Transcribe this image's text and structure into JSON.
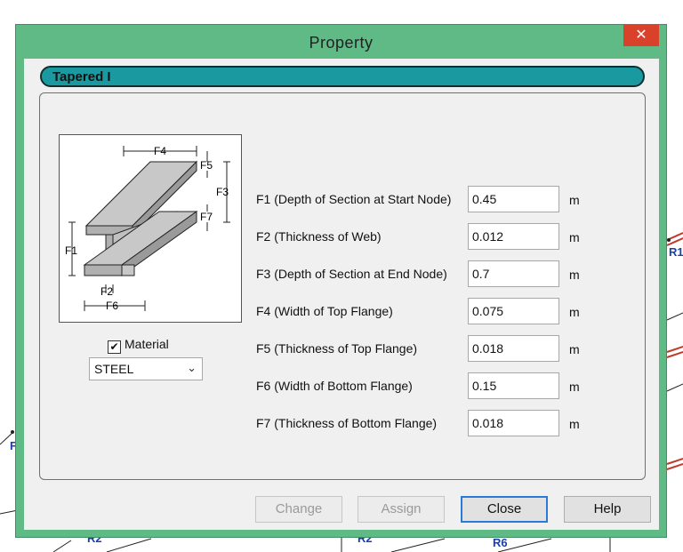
{
  "window": {
    "title": "Property",
    "close_glyph": "✕"
  },
  "section_header": "Tapered I",
  "diagram": {
    "labels": {
      "F1": "F1",
      "F2": "F2",
      "F3": "F3",
      "F4": "F4",
      "F5": "F5",
      "F6": "F6",
      "F7": "F7"
    }
  },
  "material": {
    "checked": true,
    "check_glyph": "✔",
    "label": "Material",
    "selected": "STEEL",
    "chevron": "⌄"
  },
  "properties": [
    {
      "label": "F1 (Depth of Section at Start Node)",
      "value": "0.45",
      "unit": "m"
    },
    {
      "label": "F2 (Thickness of Web)",
      "value": "0.012",
      "unit": "m"
    },
    {
      "label": "F3 (Depth of Section at End Node)",
      "value": "0.7",
      "unit": "m"
    },
    {
      "label": "F4 (Width of Top Flange)",
      "value": "0.075",
      "unit": "m"
    },
    {
      "label": "F5 (Thickness of Top Flange)",
      "value": "0.018",
      "unit": "m"
    },
    {
      "label": "F6 (Width of Bottom Flange)",
      "value": "0.15",
      "unit": "m"
    },
    {
      "label": "F7 (Thickness of Bottom Flange)",
      "value": "0.018",
      "unit": "m"
    }
  ],
  "buttons": {
    "change": "Change",
    "assign": "Assign",
    "close": "Close",
    "help": "Help"
  },
  "background": {
    "labels": [
      "R1",
      "R2",
      "R2",
      "R6",
      "F"
    ]
  },
  "colors": {
    "dialog_frame": "#5fba86",
    "header_teal": "#1a9aa0",
    "close_red": "#d9412b",
    "bg_label_blue": "#1a3fb0"
  }
}
